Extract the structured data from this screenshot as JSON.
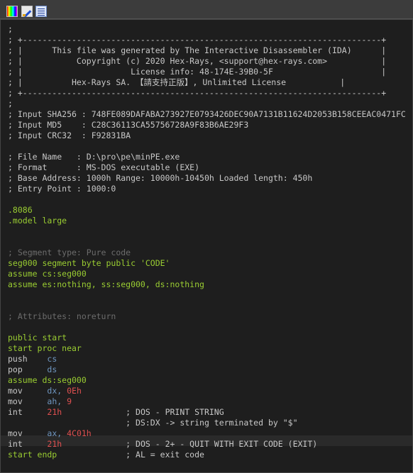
{
  "toolbar": {
    "buttons": [
      {
        "name": "color-palette-icon"
      },
      {
        "name": "edit-pen-icon"
      },
      {
        "name": "view-list-icon"
      }
    ]
  },
  "listing": {
    "lines": [
      {
        "text": ";"
      },
      {
        "text": "; +-------------------------------------------------------------------------+"
      },
      {
        "text": "; |      This file was generated by The Interactive Disassembler (IDA)      |"
      },
      {
        "text": "; |           Copyright (c) 2020 Hex-Rays, <support@hex-rays.com>           |"
      },
      {
        "text": "; |                      License info: 48-174E-39B0-5F                      |"
      },
      {
        "text": "; |          Hex-Rays SA. 【請支持正版】, Unlimited License           |"
      },
      {
        "text": "; +-------------------------------------------------------------------------+"
      },
      {
        "text": ";"
      },
      {
        "text": "; Input SHA256 : 748FE089DAFABA273927E0793426DEC90A7131B11624D2053B158CEEAC0471FC"
      },
      {
        "text": "; Input MD5    : C28C36113CA55756728A9F83B6AE29F3"
      },
      {
        "text": "; Input CRC32  : F92831BA"
      },
      {
        "text": ""
      },
      {
        "text": "; File Name   : D:\\pro\\pe\\minPE.exe"
      },
      {
        "text": "; Format      : MS-DOS executable (EXE)"
      },
      {
        "text": "; Base Address: 1000h Range: 10000h-10450h Loaded length: 450h"
      },
      {
        "text": "; Entry Point : 1000:0"
      },
      {
        "text": ""
      },
      {
        "text": ".8086"
      },
      {
        "text": ".model large"
      },
      {
        "text": ""
      },
      {
        "text": ""
      },
      {
        "text": "; Segment type: Pure code"
      },
      {
        "text": "seg000 segment byte public 'CODE'"
      },
      {
        "text": "assume cs:seg000"
      },
      {
        "text": "assume es:nothing, ss:seg000, ds:nothing"
      },
      {
        "text": ""
      },
      {
        "text": ""
      },
      {
        "text": "; Attributes: noreturn"
      },
      {
        "text": ""
      },
      {
        "text": "public start"
      },
      {
        "text": "start proc near"
      },
      {
        "text": "push    cs"
      },
      {
        "text": "pop     ds"
      },
      {
        "text": "assume ds:seg000"
      },
      {
        "text": "mov     dx, 0Eh"
      },
      {
        "text": "mov     ah, 9"
      },
      {
        "text": "int     21h             ; DOS - PRINT STRING"
      },
      {
        "text": "                        ; DS:DX -> string terminated by \"$\""
      },
      {
        "text": "mov     ax, 4C01h"
      },
      {
        "text": "int     21h             ; DOS - 2+ - QUIT WITH EXIT CODE (EXIT)"
      },
      {
        "text": "start endp              ; AL = exit code"
      }
    ]
  },
  "code": {
    "l01": ";",
    "l02": "; +-------------------------------------------------------------------------+",
    "l03": "; |      This file was generated by The Interactive Disassembler (IDA)      |",
    "l04": "; |           Copyright (c) 2020 Hex-Rays, <support@hex-rays.com>           |",
    "l05": "; |                      License info: 48-174E-39B0-5F                      |",
    "l06": "; |          Hex-Rays SA. 【請支持正版】, Unlimited License           |",
    "l07": "; +-------------------------------------------------------------------------+",
    "l08": ";",
    "l09": "; Input SHA256 : 748FE089DAFABA273927E0793426DEC90A7131B11624D2053B158CEEAC0471FC",
    "l10": "; Input MD5    : C28C36113CA55756728A9F83B6AE29F3",
    "l11": "; Input CRC32  : F92831BA",
    "l13": "; File Name   : D:\\pro\\pe\\minPE.exe",
    "l14": "; Format      : MS-DOS executable (EXE)",
    "l15": "; Base Address: 1000h Range: 10000h-10450h Loaded length: 450h",
    "l16": "; Entry Point : 1000:0",
    "l18": ".8086",
    "l19": ".model large",
    "l22": "; Segment type: Pure code",
    "l23_kw": "seg000 segment byte public ",
    "l23_str": "'CODE'",
    "l24": "assume cs:seg000",
    "l25": "assume es:nothing, ss:seg000, ds:nothing",
    "l28": "; Attributes: noreturn",
    "l30": "public start",
    "l31": "start proc near",
    "push_m": "push    ",
    "push_o": "cs",
    "pop_m": "pop     ",
    "pop_o": "ds",
    "l34": "assume ds:seg000",
    "mov1_m": "mov     ",
    "mov1_o": "dx, ",
    "mov1_n": "0Eh",
    "mov2_m": "mov     ",
    "mov2_o": "ah, ",
    "mov2_n": "9",
    "int1_m": "int     ",
    "int1_n": "21h",
    "int1_c": "             ; DOS - PRINT STRING",
    "cont_c": "                        ; DS:DX -> string terminated by \"$\"",
    "mov3_m": "mov     ",
    "mov3_o": "ax, ",
    "mov3_n": "4C01h",
    "int2_m": "int     ",
    "int2_n": "21h",
    "int2_c": "             ; DOS - 2+ - QUIT WITH EXIT CODE (EXIT)",
    "end_m": "start endp",
    "end_c": "              ; AL = exit code"
  },
  "colors": {
    "background": "#1e1e1e",
    "comment": "#c8c8c8",
    "dim_comment": "#6c6c6c",
    "keyword": "#9acd32",
    "operand": "#6f96c0",
    "number": "#e05050"
  }
}
